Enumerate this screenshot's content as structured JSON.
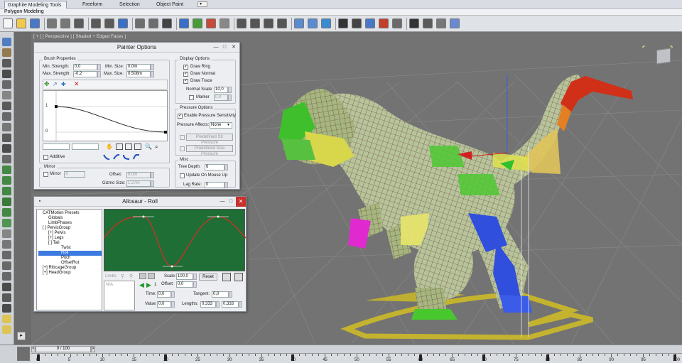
{
  "ribbon": {
    "tabs": [
      "Graphite Modeling Tools",
      "Freeform",
      "Selection",
      "Object Paint"
    ],
    "sub_label": "Polygon Modeling"
  },
  "viewport": {
    "label": "[ + ] [ Perspective ] [ Shaded + Edged Faces ]"
  },
  "painter": {
    "title": "Painter Options",
    "brush_properties": "Brush Properties",
    "min_strength_label": "Min. Strength:",
    "min_strength": "0,0",
    "max_strength_label": "Max. Strength:",
    "max_strength": "-0,2",
    "min_size_label": "Min. Size:",
    "min_size": "0,0m",
    "max_size_label": "Max. Size:",
    "max_size": "0,508m",
    "curve_y_top": "1",
    "curve_y_bottom": "0",
    "additive": "Additive",
    "mirror_group": "Mirror",
    "mirror_label": "Mirror",
    "mirror_axis": "X",
    "offset_label": "Offset:",
    "offset_value": "0,0m",
    "gizmo_label": "Gizmo Size:",
    "gizmo_value": "1,27m",
    "display_options": "Display Options",
    "draw_ring": "Draw Ring",
    "draw_normal": "Draw Normal",
    "draw_trace": "Draw Trace",
    "normal_scale_label": "Normal Scale:",
    "normal_scale": "10,0",
    "marker_label": "Marker",
    "marker_value": "0,0",
    "pressure_options": "Pressure Options",
    "enable_pressure": "Enable Pressure Sensitivity",
    "pressure_affects_label": "Pressure Affects:",
    "pressure_affects": "None",
    "predef_str": "Predefined Str Pressure",
    "predef_size": "Predefined Size Pressure",
    "misc": "Misc",
    "tree_depth_label": "Tree Depth:",
    "tree_depth": "6",
    "update_on_mouse_up": "Update On Mouse Up",
    "lag_rate_label": "Lag Rate:",
    "lag_rate": "0"
  },
  "catmotion": {
    "title": "Allosaur - Roll",
    "tree": [
      "CATMotion Presets",
      "Globals",
      "LimbPhases",
      "[ ] PelvisGroup",
      "[+] Pelvis",
      "[+] Legs",
      "[ ] Tail",
      "Twist",
      "Roll",
      "Pitch",
      "OffsetRot",
      "[+] RibcageGroup",
      "[+] HeadGroup"
    ],
    "limbs_label": "Limbs",
    "na_label": "N/A",
    "page_num": "1",
    "scale_label": "Scale:",
    "scale_value": "100,0",
    "reset_button": "Reset",
    "offset_label": "Offset:",
    "offset_value": "0,0",
    "time_label": "Time:",
    "time_value": "0,0",
    "tangent_label": "Tangent:",
    "tangent_value": "0,0",
    "value_label": "Value:",
    "value_value": "0,0",
    "lengths_label": "Lengths:",
    "length1": "0,333",
    "length2": "0,333"
  },
  "timeline": {
    "slider_text": "0 / 100",
    "ticks": [
      "0",
      "5",
      "10",
      "15",
      "20",
      "25",
      "30",
      "35",
      "40",
      "45",
      "50",
      "55",
      "60",
      "65",
      "70",
      "75",
      "80",
      "85",
      "90",
      "95",
      "100"
    ]
  },
  "colors": {
    "curve_bg": "#1e6e35",
    "accent": "#3b7ae0",
    "viewport": "#737373"
  }
}
